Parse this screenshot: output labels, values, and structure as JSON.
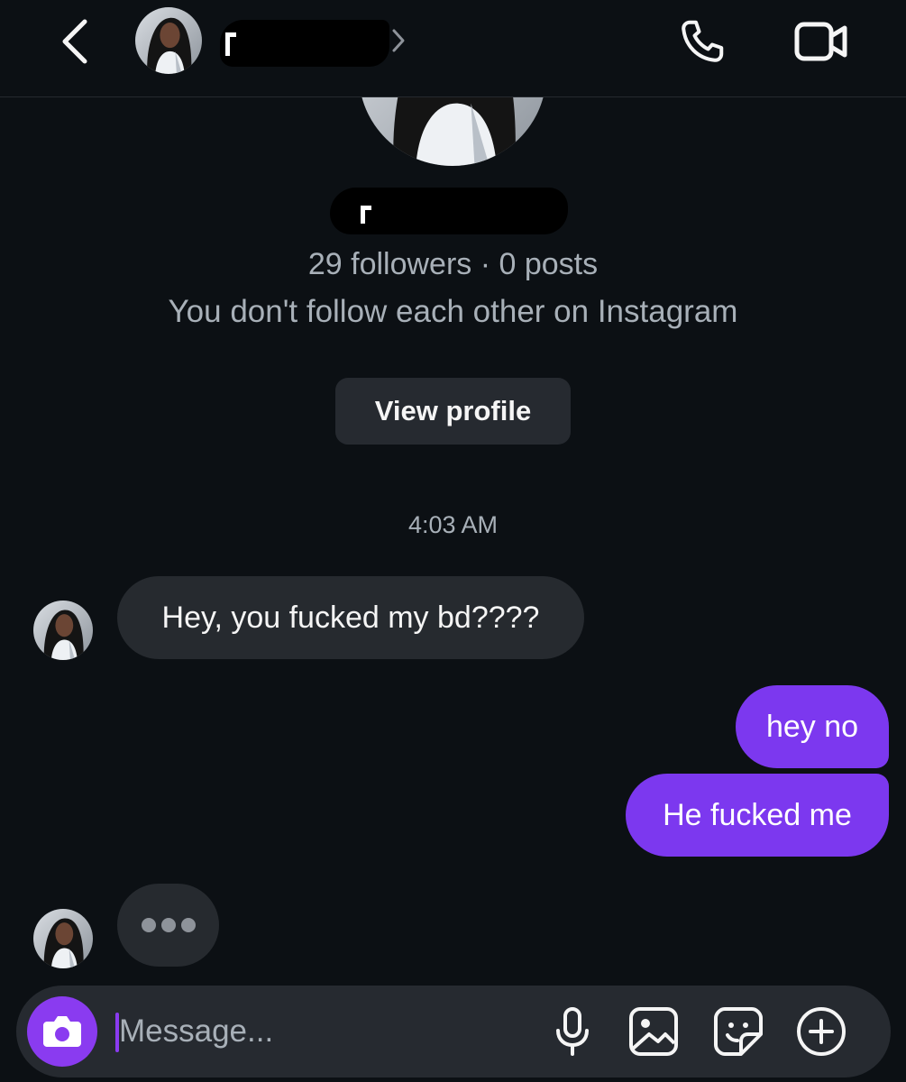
{
  "header": {
    "icons": {
      "back": "chevron-left-icon",
      "name_chevron": "chevron-right-icon",
      "call": "phone-icon",
      "video": "video-camera-icon"
    }
  },
  "profile": {
    "followers_line": "29 followers · 0 posts",
    "follow_status": "You don't follow each other on Instagram",
    "view_profile_label": "View profile"
  },
  "thread": {
    "timestamp": "4:03 AM",
    "messages": [
      {
        "from": "them",
        "text": "Hey, you fucked my bd????"
      },
      {
        "from": "me",
        "text": "hey no"
      },
      {
        "from": "me",
        "text": "He fucked me"
      }
    ],
    "typing_indicator": "typing-dots"
  },
  "composer": {
    "placeholder": "Message...",
    "icons": [
      "camera-icon",
      "microphone-icon",
      "image-icon",
      "sticker-icon",
      "plus-circle-icon"
    ]
  },
  "colors": {
    "background": "#0c1014",
    "incoming_bubble": "#262a2f",
    "outgoing_bubble": "#7c38ef",
    "accent": "#8a3bf0",
    "secondary_text": "#a8b0b8"
  }
}
